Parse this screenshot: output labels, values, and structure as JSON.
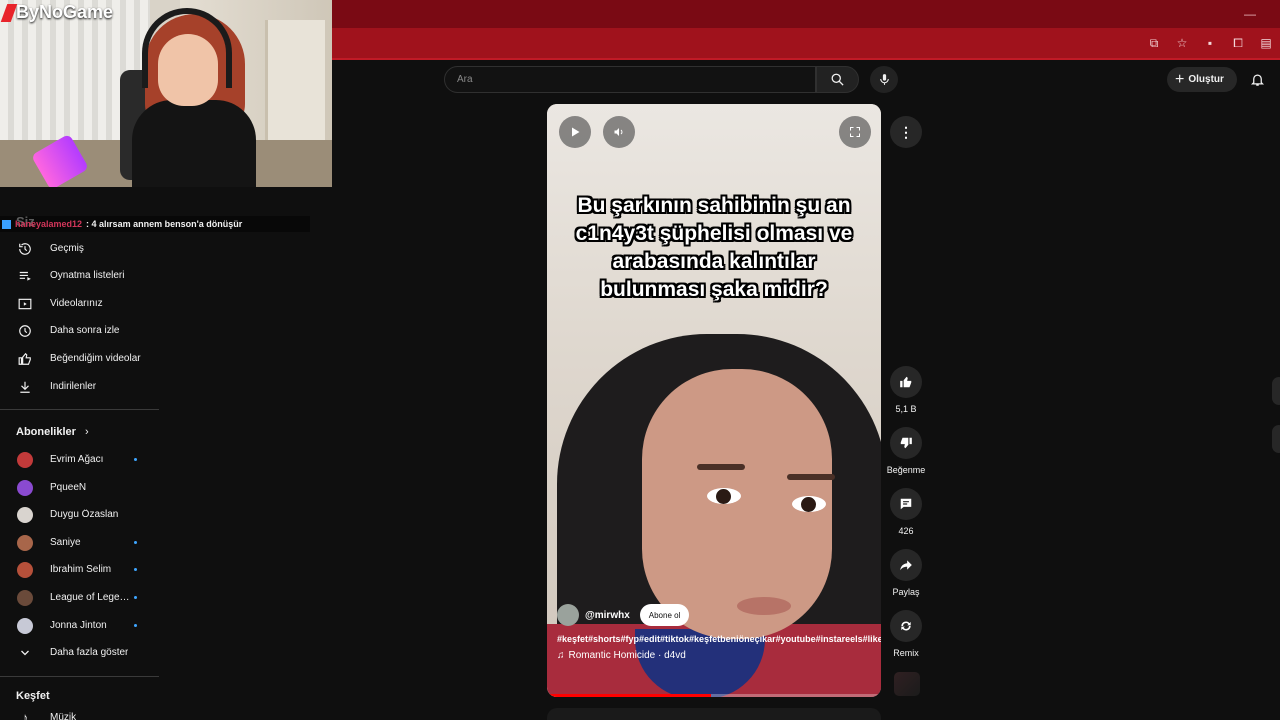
{
  "overlay": {
    "logo_text": "ByNoGame",
    "chat": {
      "user": "haneyalamed12",
      "message": ": 4 alırsam annem benson'a dönüşür"
    }
  },
  "sidebar": {
    "you_label": "Siz",
    "you_items": [
      {
        "icon": "history-icon",
        "label": "Geçmiş"
      },
      {
        "icon": "playlist-icon",
        "label": "Oynatma listeleri"
      },
      {
        "icon": "your-videos-icon",
        "label": "Videolarınız"
      },
      {
        "icon": "watch-later-icon",
        "label": "Daha sonra izle"
      },
      {
        "icon": "like-icon",
        "label": "Beğendiğim videolar"
      },
      {
        "icon": "download-icon",
        "label": "İndirilenler"
      }
    ],
    "subs_title": "Abonelikler",
    "subscriptions": [
      {
        "label": "Evrim Ağacı",
        "new": true,
        "color": "#c23a3a"
      },
      {
        "label": "PqueeN",
        "new": false,
        "color": "#8a4ad0"
      },
      {
        "label": "Duygu Özaslan",
        "new": false,
        "color": "#d9d4cf"
      },
      {
        "label": "Saniye",
        "new": true,
        "color": "#a8664a"
      },
      {
        "label": "İbrahim Selim",
        "new": true,
        "color": "#b5503a"
      },
      {
        "label": "League of Legen...",
        "new": true,
        "color": "#6a4a3a"
      },
      {
        "label": "Jonna Jinton",
        "new": true,
        "color": "#c7c9d6"
      }
    ],
    "show_more": "Daha fazla göster",
    "explore_title": "Keşfet",
    "explore_first": "Müzik"
  },
  "topbar": {
    "search_placeholder": "Ara",
    "create_label": "Oluştur"
  },
  "short": {
    "caption": "Bu şarkının sahibinin şu an c1n4y3t şüphelisi olması ve arabasında kalıntılar bulunması şaka midir?",
    "channel": "@mirwhx",
    "subscribe_label": "Abone ol",
    "hashtags": "#keşfet#shorts#fyp#edit#tiktok#keşfetbeniöneçıkar#youtube#instareels#likes#beniöneçıkar#keşfetteyiz",
    "sound": "Romantic Homicide · d4vd",
    "progress": 0.49
  },
  "actions": {
    "likes": "5,1 B",
    "dislike_label": "Beğenme",
    "comments": "426",
    "share_label": "Paylaş",
    "remix_label": "Remix"
  }
}
